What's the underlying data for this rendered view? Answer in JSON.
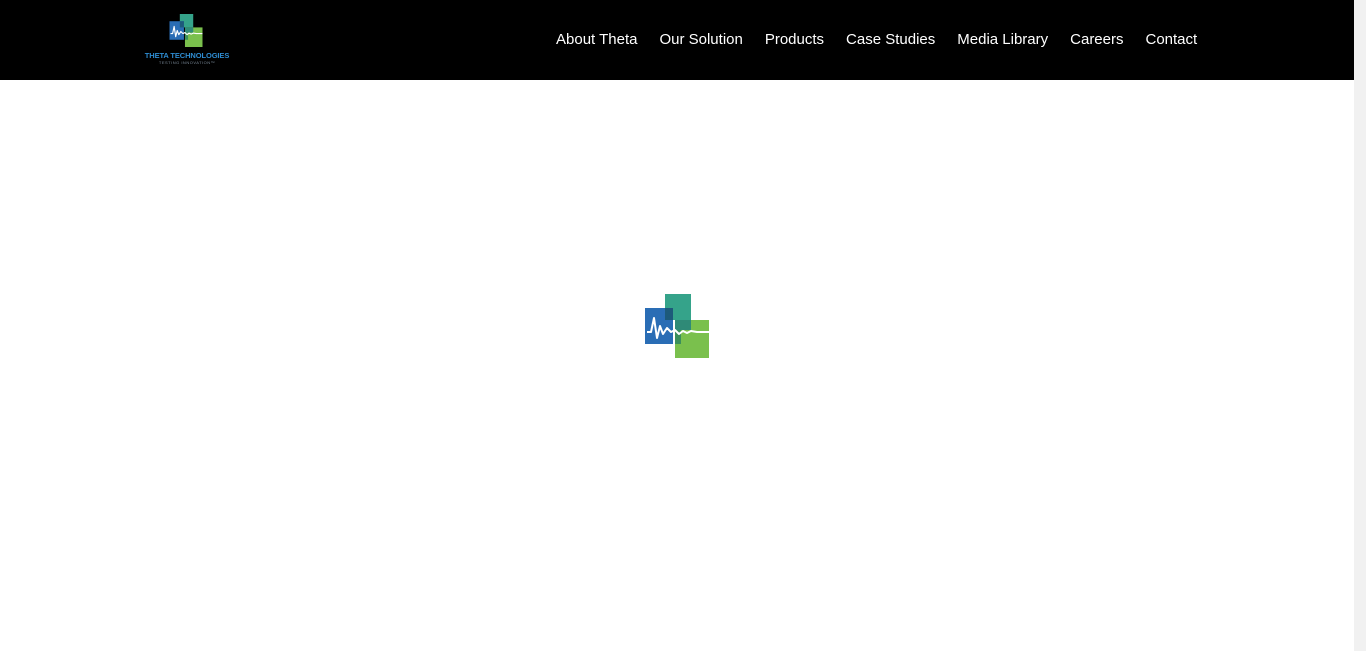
{
  "brand": {
    "name": "THETA TECHNOLOGIES",
    "tagline": "TESTING INNOVATION™",
    "colors": {
      "teal": "#35a38a",
      "blue": "#2a6db5",
      "green": "#7ac04d",
      "navy": "#1d5a7a"
    }
  },
  "header": {
    "background": "#000000",
    "nav": [
      {
        "label": "About Theta"
      },
      {
        "label": "Our Solution"
      },
      {
        "label": "Products"
      },
      {
        "label": "Case Studies"
      },
      {
        "label": "Media Library"
      },
      {
        "label": "Careers"
      },
      {
        "label": "Contact"
      }
    ]
  },
  "main": {
    "loader_icon": "theta-logo-icon"
  }
}
